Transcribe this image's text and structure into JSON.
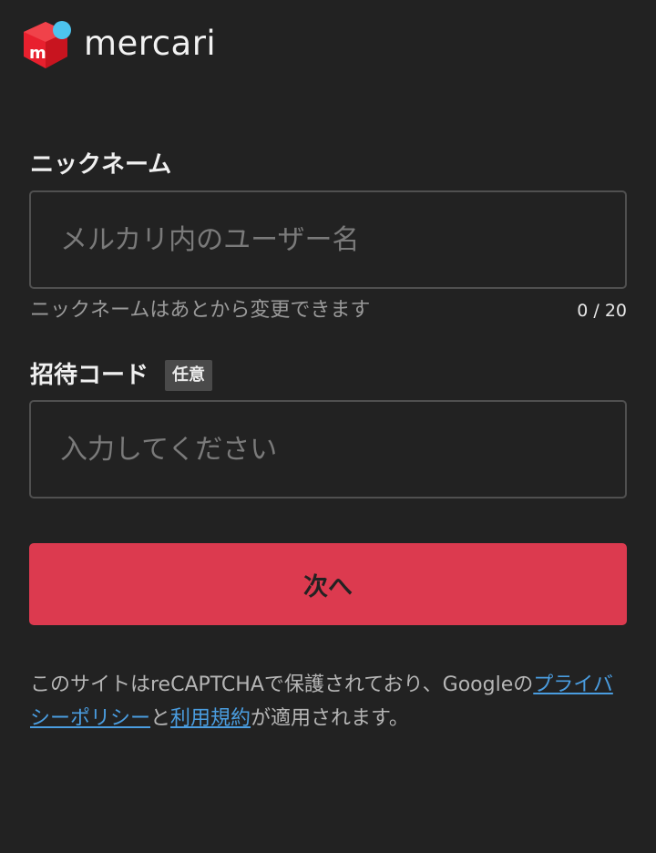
{
  "brand": {
    "name": "mercari",
    "icon": "mercari-box-icon",
    "colors": {
      "box": "#e8202e",
      "dot": "#4dc4ee"
    }
  },
  "form": {
    "nickname": {
      "label": "ニックネーム",
      "placeholder": "メルカリ内のユーザー名",
      "value": "",
      "helper": "ニックネームはあとから変更できます",
      "counter": "0 / 20"
    },
    "invite_code": {
      "label": "招待コード",
      "badge": "任意",
      "placeholder": "入力してください",
      "value": ""
    },
    "next_button": "次へ"
  },
  "notice": {
    "prefix": "このサイトはreCAPTCHAで保護されており、Googleの",
    "privacy_link": "プライバシーポリシー",
    "middle": "と",
    "terms_link": "利用規約",
    "suffix": "が適用されます。"
  },
  "colors": {
    "background": "#222222",
    "accent": "#dc3a4f",
    "link": "#4a9de0"
  }
}
